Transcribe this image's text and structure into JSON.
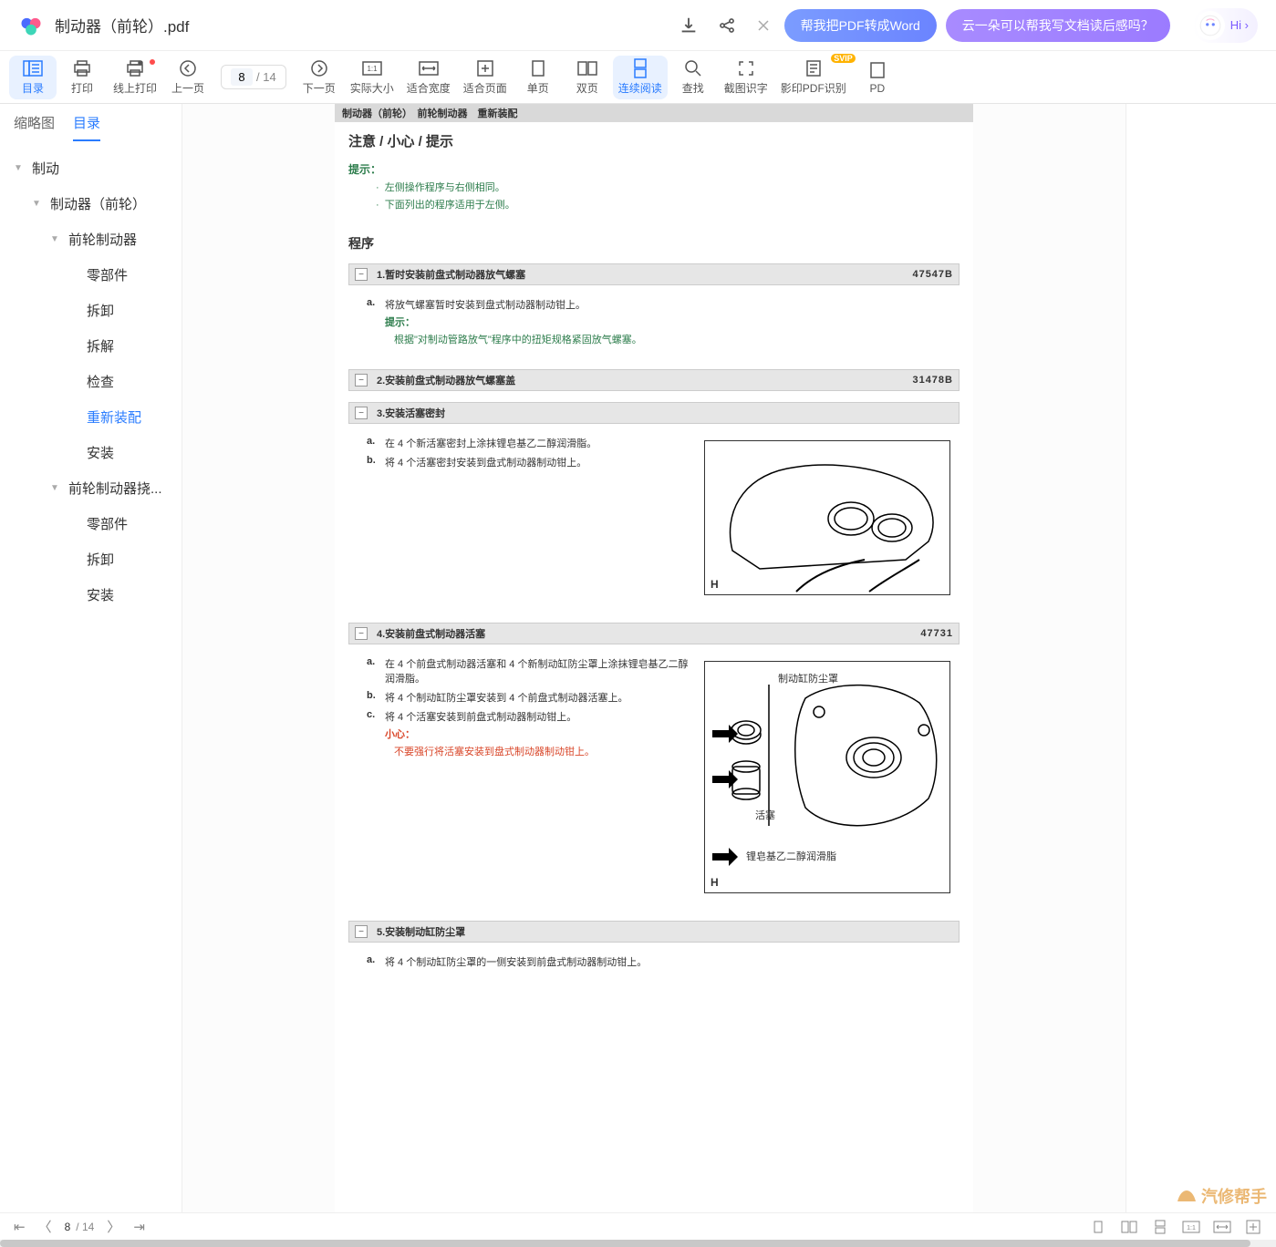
{
  "header": {
    "filename": "制动器（前轮）.pdf",
    "pills": {
      "convert": "帮我把PDF转成Word",
      "summary": "云一朵可以帮我写文档读后感吗？"
    },
    "hi": "Hi ›"
  },
  "toolbar": {
    "items": [
      {
        "label": "目录",
        "name": "toc-button",
        "active": true
      },
      {
        "label": "打印",
        "name": "print-button"
      },
      {
        "label": "线上打印",
        "name": "online-print-button",
        "dot": true
      },
      {
        "label": "上一页",
        "name": "prev-page-button"
      },
      {
        "label": "下一页",
        "name": "next-page-button"
      },
      {
        "label": "实际大小",
        "name": "actual-size-button"
      },
      {
        "label": "适合宽度",
        "name": "fit-width-button"
      },
      {
        "label": "适合页面",
        "name": "fit-page-button"
      },
      {
        "label": "单页",
        "name": "single-page-button"
      },
      {
        "label": "双页",
        "name": "dual-page-button"
      },
      {
        "label": "连续阅读",
        "name": "continuous-read-button",
        "active": true
      },
      {
        "label": "查找",
        "name": "find-button"
      },
      {
        "label": "截图识字",
        "name": "screenshot-ocr-button"
      },
      {
        "label": "影印PDF识别",
        "name": "scan-pdf-recognize-button",
        "svip": true
      },
      {
        "label": "PD",
        "name": "pdf-tool-button"
      }
    ],
    "page_current": "8",
    "page_total": "/ 14"
  },
  "sidebar": {
    "tabs": {
      "thumb": "缩略图",
      "toc": "目录"
    },
    "tree": [
      {
        "l": 0,
        "t": "制动",
        "caret": true
      },
      {
        "l": 1,
        "t": "制动器（前轮）",
        "caret": true
      },
      {
        "l": 2,
        "t": "前轮制动器",
        "caret": true
      },
      {
        "l": 3,
        "t": "零部件"
      },
      {
        "l": 3,
        "t": "拆卸"
      },
      {
        "l": 3,
        "t": "拆解"
      },
      {
        "l": 3,
        "t": "检查"
      },
      {
        "l": 3,
        "t": "重新装配",
        "active": true
      },
      {
        "l": 3,
        "t": "安装"
      },
      {
        "l": 2,
        "t": "前轮制动器挠...",
        "caret": true
      },
      {
        "l": 3,
        "t": "零部件"
      },
      {
        "l": 3,
        "t": "拆卸"
      },
      {
        "l": 3,
        "t": "安装"
      }
    ]
  },
  "doc": {
    "crumb": "制动器（前轮）　前轮制动器　重新装配",
    "title": "注意 / 小心 / 提示",
    "hint_label": "提示：",
    "hints": [
      "左侧操作程序与右侧相同。",
      "下面列出的程序适用于左侧。"
    ],
    "proc_title": "程序",
    "steps": [
      {
        "no": "1.",
        "title": "暂时安装前盘式制动器放气螺塞",
        "code": "47547B",
        "subs": [
          {
            "l": "a.",
            "t": "将放气螺塞暂时安装到盘式制动器制动钳上。",
            "hint_label": "提示：",
            "hint": "根据\"对制动管路放气\"程序中的扭矩规格紧固放气螺塞。"
          }
        ]
      },
      {
        "no": "2.",
        "title": "安装前盘式制动器放气螺塞盖",
        "code": "31478B"
      },
      {
        "no": "3.",
        "title": "安装活塞密封",
        "subs": [
          {
            "l": "a.",
            "t": "在 4 个新活塞密封上涂抹锂皂基乙二醇润滑脂。"
          },
          {
            "l": "b.",
            "t": "将 4 个活塞密封安装到盘式制动器制动钳上。"
          }
        ],
        "figure": 1
      },
      {
        "no": "4.",
        "title": "安装前盘式制动器活塞",
        "code": "47731",
        "subs": [
          {
            "l": "a.",
            "t": "在 4 个前盘式制动器活塞和 4 个新制动缸防尘罩上涂抹锂皂基乙二醇润滑脂。"
          },
          {
            "l": "b.",
            "t": "将 4 个制动缸防尘罩安装到 4 个前盘式制动器活塞上。"
          },
          {
            "l": "c.",
            "t": "将 4 个活塞安装到前盘式制动器制动钳上。",
            "caution_label": "小心：",
            "caution": "不要强行将活塞安装到盘式制动器制动钳上。"
          }
        ],
        "figure": 2,
        "callouts": {
          "boot": "制动缸防尘罩",
          "piston": "活塞",
          "grease": "锂皂基乙二醇润滑脂"
        }
      },
      {
        "no": "5.",
        "title": "安装制动缸防尘罩",
        "subs": [
          {
            "l": "a.",
            "t": "将 4 个制动缸防尘罩的一侧安装到前盘式制动器制动钳上。"
          }
        ]
      }
    ]
  },
  "footer": {
    "page_current": "8",
    "page_total": "/ 14"
  },
  "watermark": "汽修帮手"
}
